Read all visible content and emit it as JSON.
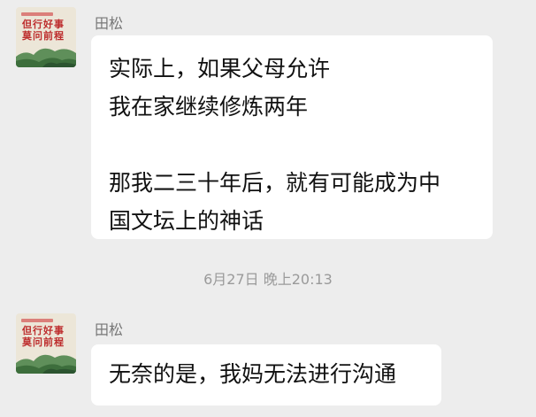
{
  "chat": {
    "messages": [
      {
        "sender": "田松",
        "avatar": {
          "line1": "但行好事",
          "line2": "莫问前程"
        },
        "lines": [
          "实际上，如果父母允许",
          "我在家继续修炼两年",
          "",
          "那我二三十年后，就有可能成为中",
          "国文坛上的神话"
        ]
      },
      {
        "sender": "田松",
        "avatar": {
          "line1": "但行好事",
          "line2": "莫问前程"
        },
        "lines": [
          "无奈的是，我妈无法进行沟通"
        ]
      }
    ],
    "timestamp": "6月27日 晚上20:13"
  }
}
